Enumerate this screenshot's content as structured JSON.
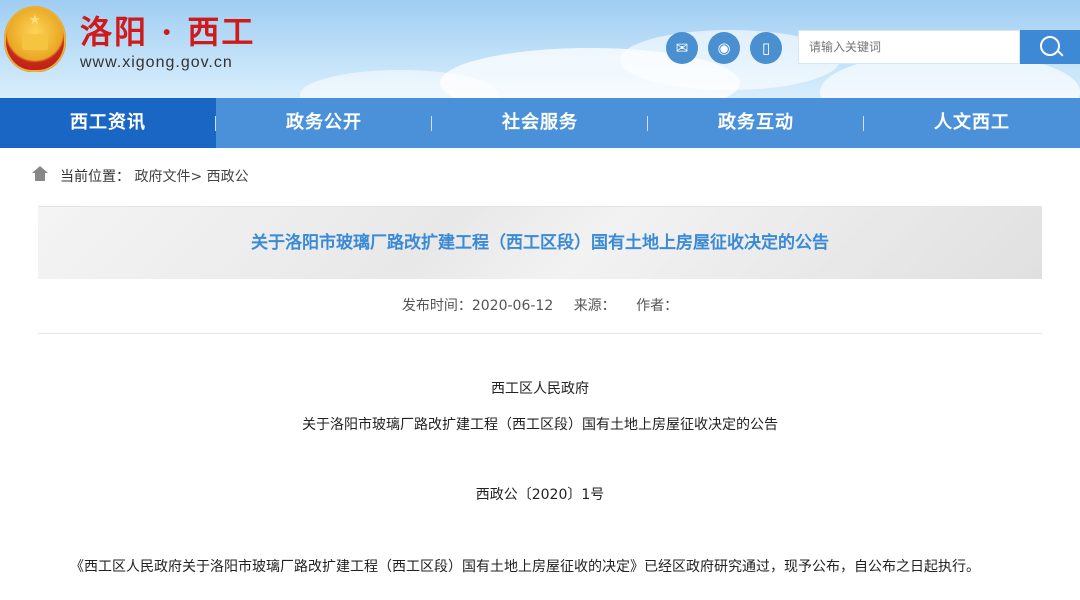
{
  "header": {
    "site_title": "洛阳 · 西工",
    "site_url": "www.xigong.gov.cn",
    "search": {
      "placeholder": "请输入关键词"
    },
    "social": [
      "wechat-icon",
      "weibo-icon",
      "mobile-icon"
    ]
  },
  "nav": {
    "items": [
      {
        "label": "西工资讯",
        "active": true
      },
      {
        "label": "政务公开"
      },
      {
        "label": "社会服务"
      },
      {
        "label": "政务互动"
      },
      {
        "label": "人文西工"
      }
    ]
  },
  "breadcrumb": {
    "label": "当前位置：",
    "items": [
      "政府文件>",
      "西政公"
    ]
  },
  "article": {
    "title": "关于洛阳市玻璃厂路改扩建工程（西工区段）国有土地上房屋征收决定的公告",
    "publish_time": "发布时间：2020-06-12",
    "source": "来源：",
    "author": "作者：",
    "paragraphs": [
      "西工区人民政府",
      "关于洛阳市玻璃厂路改扩建工程（西工区段）国有土地上房屋征收决定的公告",
      "西政公〔2020〕1号",
      "《西工区人民政府关于洛阳市玻璃厂路改扩建工程（西工区段）国有土地上房屋征收的决定》已经区政府研究通过，现予公布，自公布之日起执行。"
    ]
  },
  "colors": {
    "brand_red": "#d0191b",
    "nav_blue": "#4a91d9",
    "nav_active": "#1a66c4",
    "title_blue": "#3a8ad6"
  }
}
